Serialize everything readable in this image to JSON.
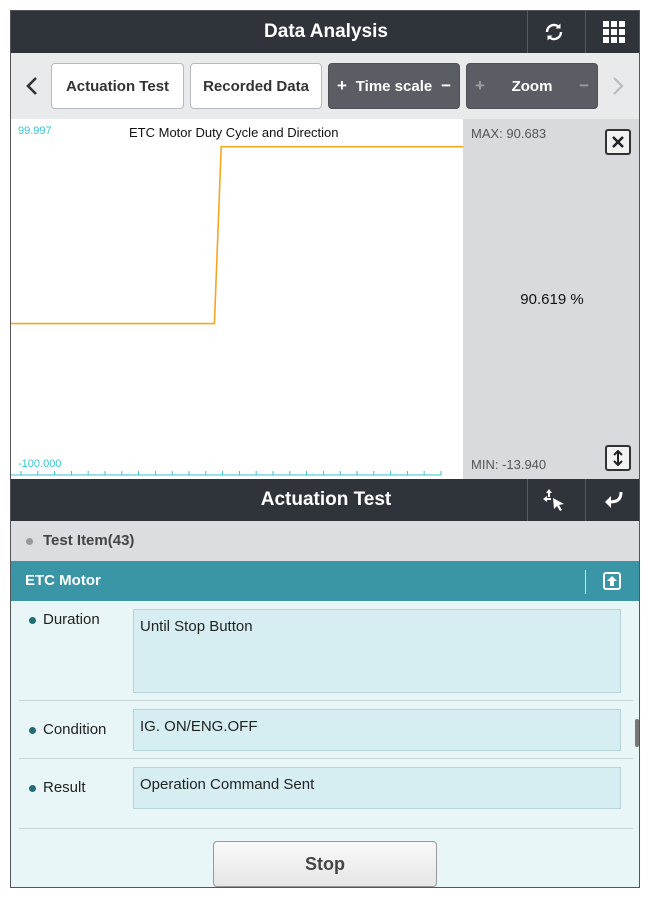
{
  "header": {
    "title": "Data Analysis",
    "refresh_icon": "refresh-icon",
    "grid_icon": "grid-menu-icon"
  },
  "toolbar": {
    "prev_icon": "chevron-left-icon",
    "next_icon": "chevron-right-icon",
    "actuation_test": "Actuation Test",
    "recorded_data": "Recorded Data",
    "time_scale": "Time scale",
    "zoom": "Zoom",
    "plus": "+",
    "minus": "−"
  },
  "graph": {
    "title": "ETC Motor Duty Cycle and Direction",
    "y_max_label": "99.997",
    "y_min_label": "-100.000",
    "max_text": "MAX: 90.683",
    "min_text": "MIN: -13.940",
    "current_value": "90.619 %",
    "line_color": "#f5a623",
    "label_color": "#34c6d6"
  },
  "chart_data": {
    "type": "line",
    "title": "ETC Motor Duty Cycle and Direction",
    "ylim": [
      -100.0,
      99.997
    ],
    "y_unit": "%",
    "series": [
      {
        "points": [
          [
            0,
            -13.94
          ],
          [
            0.45,
            -13.94
          ],
          [
            0.465,
            90.683
          ],
          [
            1.0,
            90.683
          ]
        ]
      }
    ],
    "max": 90.683,
    "min": -13.94,
    "current": 90.619
  },
  "actuation": {
    "title": "Actuation Test",
    "test_item": "Test Item(43)",
    "selected_item": "ETC Motor",
    "rows": [
      {
        "label": "Duration",
        "value": "Until Stop Button"
      },
      {
        "label": "Condition",
        "value": "IG. ON/ENG.OFF"
      },
      {
        "label": "Result",
        "value": "Operation Command Sent"
      }
    ],
    "stop_label": "Stop"
  }
}
